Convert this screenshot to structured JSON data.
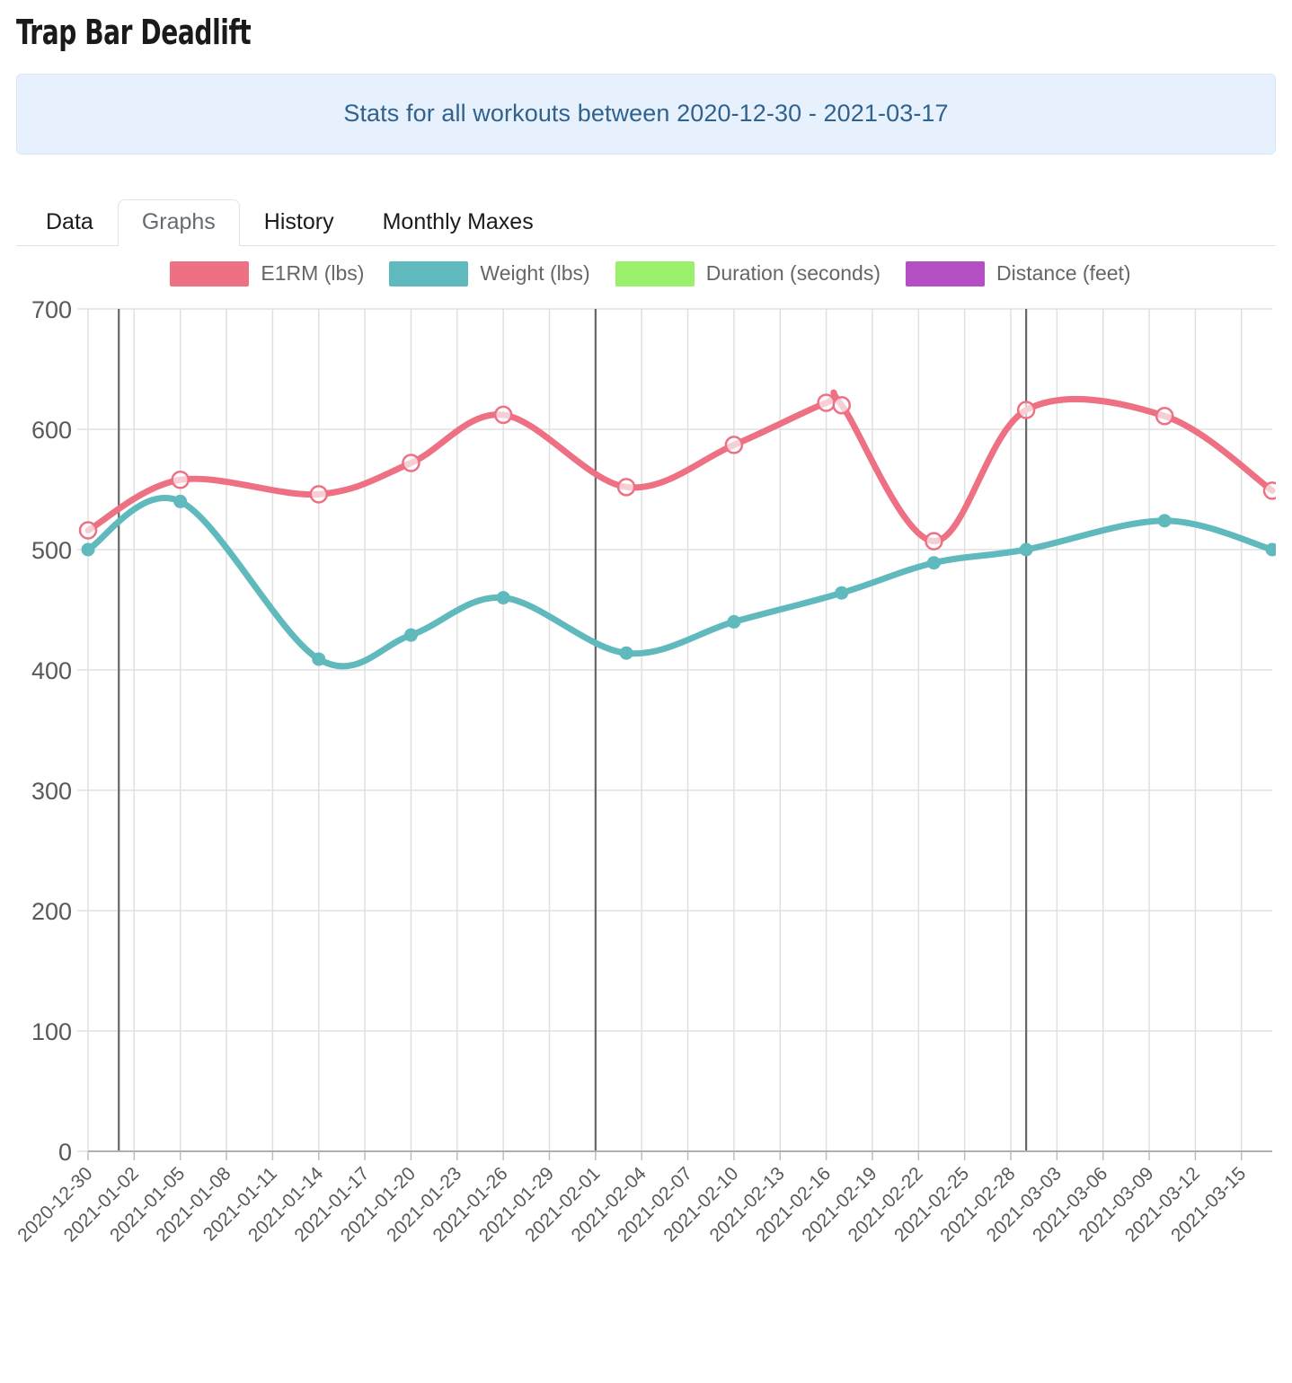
{
  "header": {
    "title": "Trap Bar Deadlift",
    "banner": "Stats for all workouts between 2020-12-30 - 2021-03-17"
  },
  "tabs": [
    {
      "label": "Data",
      "active": false
    },
    {
      "label": "Graphs",
      "active": true
    },
    {
      "label": "History",
      "active": false
    },
    {
      "label": "Monthly Maxes",
      "active": false
    }
  ],
  "colors": {
    "e1rm": "#ed7083",
    "weight": "#5fb9bd",
    "duration": "#9bf06b",
    "distance": "#b54fc4",
    "banner_bg": "#e7f1fd",
    "banner_text": "#31628d",
    "grid": "#e0e0e0",
    "month_line": "#666666"
  },
  "chart_data": {
    "type": "line",
    "title": "",
    "xlabel": "",
    "ylabel": "",
    "ylim": [
      0,
      700
    ],
    "yticks": [
      0,
      100,
      200,
      300,
      400,
      500,
      600,
      700
    ],
    "grid": true,
    "legend_position": "top-center",
    "xtick_labels": [
      "2020-12-30",
      "2021-01-02",
      "2021-01-05",
      "2021-01-08",
      "2021-01-11",
      "2021-01-14",
      "2021-01-17",
      "2021-01-20",
      "2021-01-23",
      "2021-01-26",
      "2021-01-29",
      "2021-02-01",
      "2021-02-04",
      "2021-02-07",
      "2021-02-10",
      "2021-02-13",
      "2021-02-16",
      "2021-02-19",
      "2021-02-22",
      "2021-02-25",
      "2021-02-28",
      "2021-03-03",
      "2021-03-06",
      "2021-03-09",
      "2021-03-12",
      "2021-03-15"
    ],
    "month_boundaries": [
      "2021-01-01",
      "2021-02-01",
      "2021-03-01"
    ],
    "series": [
      {
        "name": "E1RM (lbs)",
        "color": "#ed7083",
        "marker": "open-circle",
        "points": [
          {
            "x": "2020-12-30",
            "y": 516
          },
          {
            "x": "2021-01-05",
            "y": 558
          },
          {
            "x": "2021-01-14",
            "y": 546
          },
          {
            "x": "2021-01-20",
            "y": 572
          },
          {
            "x": "2021-01-26",
            "y": 612
          },
          {
            "x": "2021-02-03",
            "y": 552
          },
          {
            "x": "2021-02-10",
            "y": 587
          },
          {
            "x": "2021-02-16",
            "y": 622
          },
          {
            "x": "2021-02-17",
            "y": 620
          },
          {
            "x": "2021-02-23",
            "y": 507
          },
          {
            "x": "2021-03-01",
            "y": 616
          },
          {
            "x": "2021-03-10",
            "y": 611
          },
          {
            "x": "2021-03-17",
            "y": 549
          }
        ]
      },
      {
        "name": "Weight (lbs)",
        "color": "#5fb9bd",
        "marker": "filled-circle",
        "points": [
          {
            "x": "2020-12-30",
            "y": 500
          },
          {
            "x": "2021-01-05",
            "y": 540
          },
          {
            "x": "2021-01-14",
            "y": 409
          },
          {
            "x": "2021-01-20",
            "y": 429
          },
          {
            "x": "2021-01-26",
            "y": 460
          },
          {
            "x": "2021-02-03",
            "y": 414
          },
          {
            "x": "2021-02-10",
            "y": 440
          },
          {
            "x": "2021-02-17",
            "y": 464
          },
          {
            "x": "2021-02-23",
            "y": 489
          },
          {
            "x": "2021-03-01",
            "y": 500
          },
          {
            "x": "2021-03-10",
            "y": 524
          },
          {
            "x": "2021-03-17",
            "y": 500
          }
        ]
      },
      {
        "name": "Duration (seconds)",
        "color": "#9bf06b",
        "marker": "filled-circle",
        "points": []
      },
      {
        "name": "Distance (feet)",
        "color": "#b54fc4",
        "marker": "filled-circle",
        "points": []
      }
    ]
  }
}
